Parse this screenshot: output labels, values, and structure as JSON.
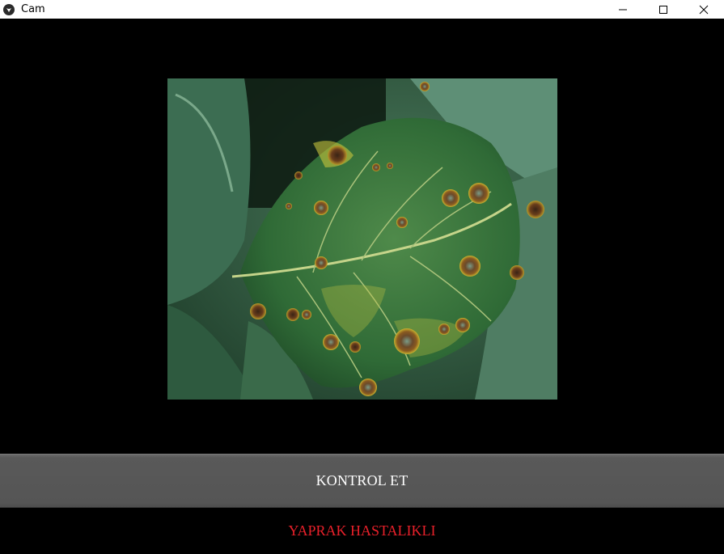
{
  "window": {
    "title": "Cam",
    "app_icon": "app-logo-icon",
    "controls": [
      "minimize-icon",
      "maximize-icon",
      "close-icon"
    ]
  },
  "camera": {
    "image": "leaf-with-disease-spots"
  },
  "actions": {
    "check_label": "KONTROL ET"
  },
  "result": {
    "text": "YAPRAK HASTALIKLI",
    "color": "#e8202a"
  },
  "colors": {
    "background": "#000000",
    "button": "#555555",
    "button_text": "#ffffff"
  }
}
